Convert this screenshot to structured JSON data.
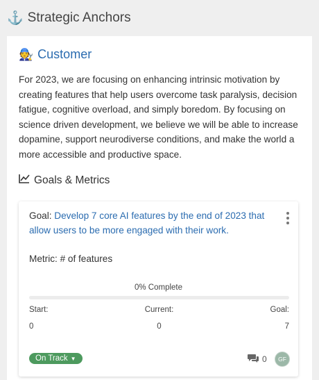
{
  "header": {
    "title": "Strategic Anchors",
    "icon": "anchor-icon"
  },
  "customer": {
    "emoji": "🧑‍🔧",
    "title": "Customer",
    "description": "For 2023, we are focusing on enhancing intrinsic motivation by creating features that help users overcome task paralysis, decision fatigue, cognitive overload, and simply boredom. By focusing on science driven development, we believe we will be able to increase dopamine, support neurodiverse conditions, and make the world a more accessible and productive space."
  },
  "goals_section": {
    "title": "Goals & Metrics",
    "icon": "line-chart-icon"
  },
  "goal": {
    "label": "Goal:",
    "text": "Develop 7 core AI features by the end of 2023 that allow users to be more engaged with their work.",
    "metric_label": "Metric:",
    "metric_value": "# of features",
    "progress_text": "0% Complete",
    "progress_fraction": 0,
    "start_label": "Start:",
    "start_value": "0",
    "current_label": "Current:",
    "current_value": "0",
    "goal_label": "Goal:",
    "goal_value": "7",
    "status": "On Track",
    "comment_count": "0",
    "avatar_initials": "GF"
  },
  "colors": {
    "link": "#2b6cb0",
    "status": "#4d9a5e",
    "progress": "#5aa469"
  }
}
